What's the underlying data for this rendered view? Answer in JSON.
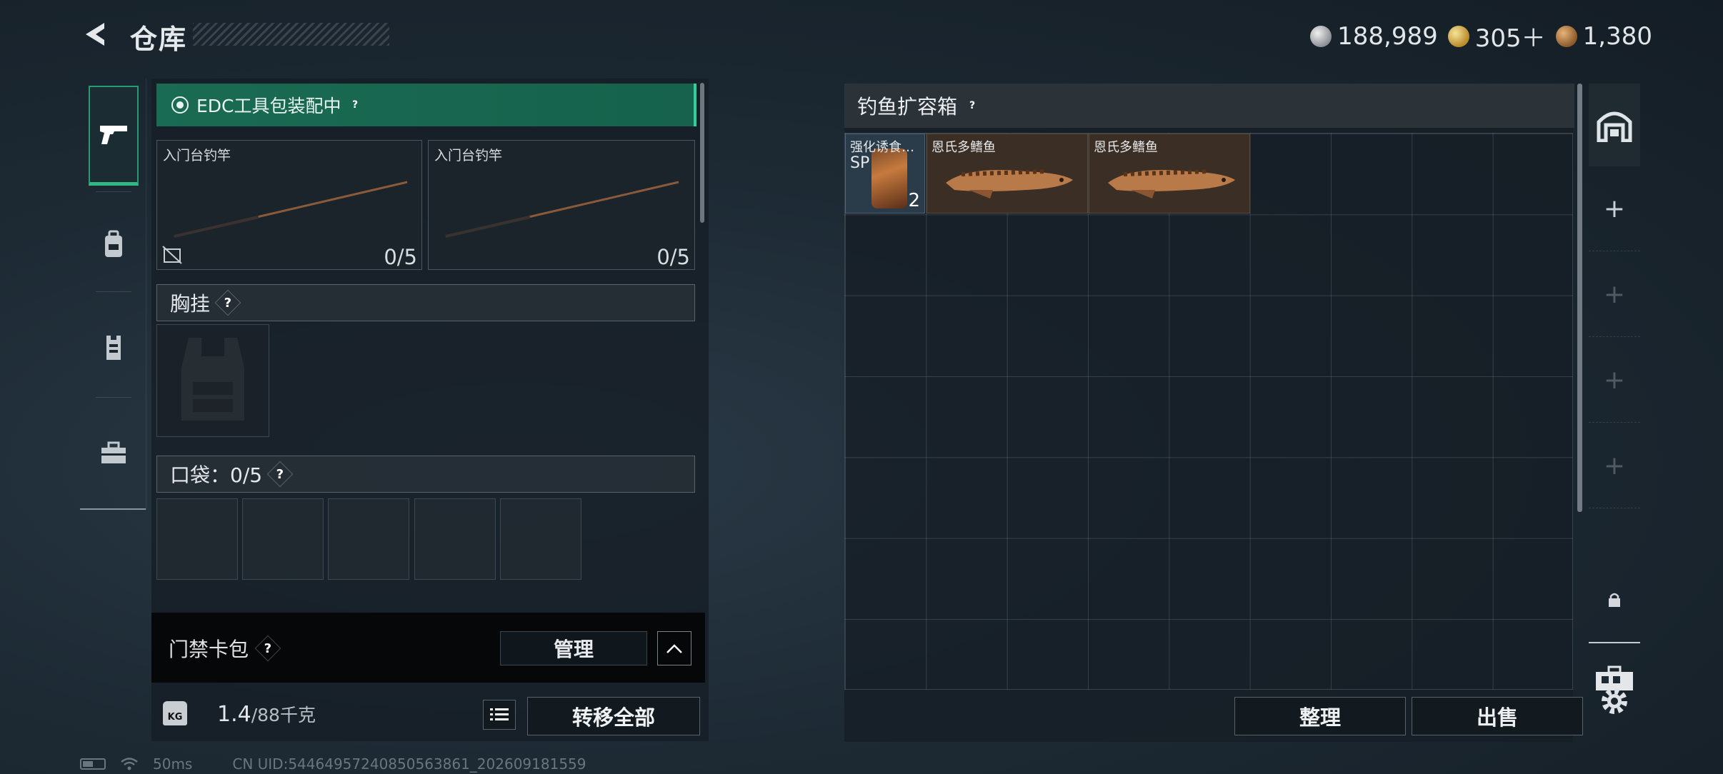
{
  "header": {
    "title": "仓库",
    "currencies": [
      {
        "icon": "silver-coin-icon",
        "value": "188,989"
      },
      {
        "icon": "gold-triangle-coin-icon",
        "value": "305＋"
      },
      {
        "icon": "bronze-coin-icon",
        "value": "1,380"
      }
    ]
  },
  "left_rail": {
    "tabs": [
      {
        "icon": "pistol-icon",
        "active": true
      },
      {
        "icon": "backpack-icon",
        "active": false
      },
      {
        "icon": "vest-icon",
        "active": false
      },
      {
        "icon": "toolbox-icon",
        "active": false
      }
    ]
  },
  "equipment": {
    "edc_status": "EDC工具包装配中",
    "rods": [
      {
        "label": "入门台钓竿",
        "count": "0/5"
      },
      {
        "label": "入门台钓竿",
        "count": "0/5"
      }
    ],
    "chest_rig_label": "胸挂",
    "pocket_label": "口袋：",
    "pocket_count": "0/5",
    "access_card_label": "门禁卡包",
    "manage_label": "管理",
    "weight_value": "1.4",
    "weight_capacity": "/88千克",
    "transfer_all_label": "转移全部"
  },
  "storage": {
    "title": "钓鱼扩容箱",
    "items": [
      {
        "label": "强化诱食…",
        "sub": "SP",
        "count": "2"
      },
      {
        "label": "恩氏多鳍鱼"
      },
      {
        "label": "恩氏多鳍鱼"
      }
    ],
    "sort_label": "整理",
    "sell_label": "出售"
  },
  "status_bar": {
    "ping": "50ms",
    "uid": "CN UID:54464957240850563861_202609181559"
  },
  "colors": {
    "accent_green": "#2fb883",
    "edc_bar": "#1a6b53",
    "panel_bg": "#161e25"
  }
}
